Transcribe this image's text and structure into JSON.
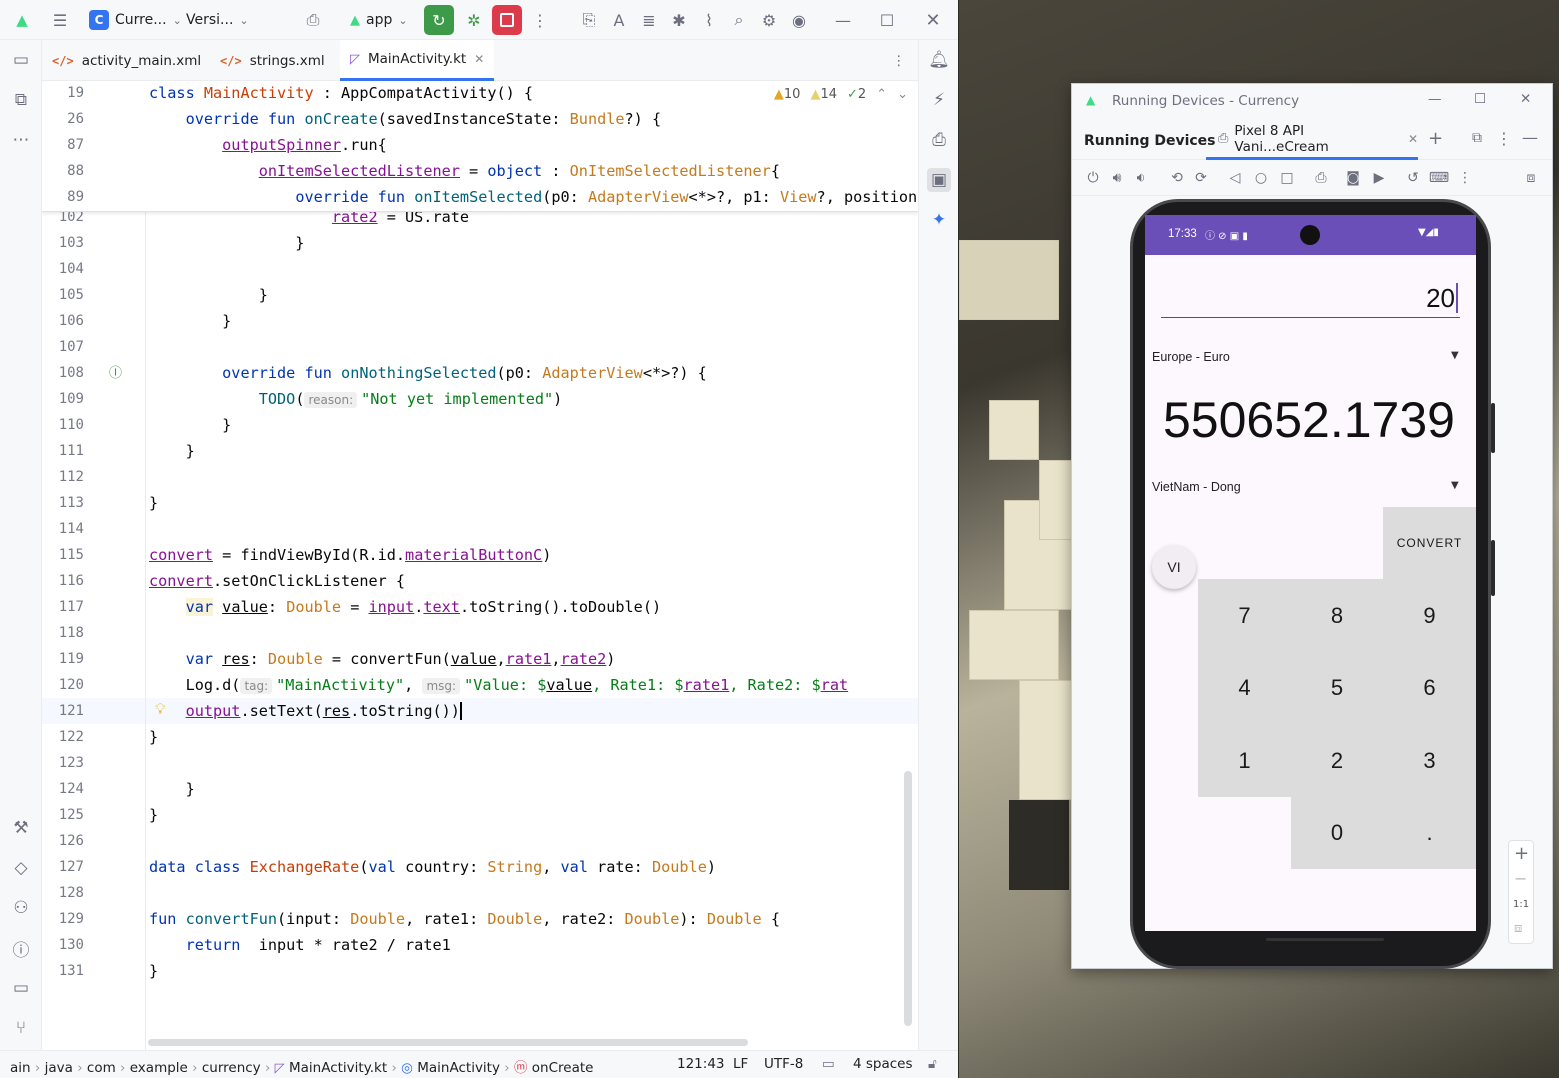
{
  "ide": {
    "project_badge": "C",
    "project_name": "Curre...",
    "vcs_branch": "Versi...",
    "run_config": "app",
    "tabs": [
      {
        "label": "activity_main.xml"
      },
      {
        "label": "strings.xml"
      },
      {
        "label": "MainActivity.kt"
      }
    ],
    "inspections": {
      "warnings": "10",
      "weak_warnings": "14",
      "ok": "2"
    },
    "line_numbers": [
      "19",
      "26",
      "87",
      "88",
      "89",
      "102",
      "103",
      "104",
      "105",
      "106",
      "107",
      "108",
      "109",
      "110",
      "111",
      "112",
      "113",
      "114",
      "115",
      "116",
      "117",
      "118",
      "119",
      "120",
      "121",
      "122",
      "123",
      "124",
      "125",
      "126",
      "127",
      "128",
      "129",
      "130",
      "131"
    ],
    "status_bar": {
      "breadcrumb": [
        "ain",
        "java",
        "com",
        "example",
        "currency",
        "MainActivity.kt",
        "MainActivity",
        "onCreate"
      ],
      "position": "121:43",
      "line_sep": "LF",
      "encoding": "UTF-8",
      "indent": "4 spaces"
    }
  },
  "running_devices": {
    "window_title": "Running Devices - Currency",
    "tab_label": "Running Devices",
    "device_tab": "Pixel 8 API Vani...eCream",
    "zoom_label": "1:1"
  },
  "phone": {
    "time": "17:33",
    "input_value": "20",
    "from_currency": "Europe - Euro",
    "result": "550652.1739",
    "to_currency": "VietNam - Dong",
    "convert_button": "CONVERT",
    "fab_label": "VI",
    "keys": [
      "7",
      "8",
      "9",
      "4",
      "5",
      "6",
      "1",
      "2",
      "3",
      "0",
      "."
    ]
  }
}
